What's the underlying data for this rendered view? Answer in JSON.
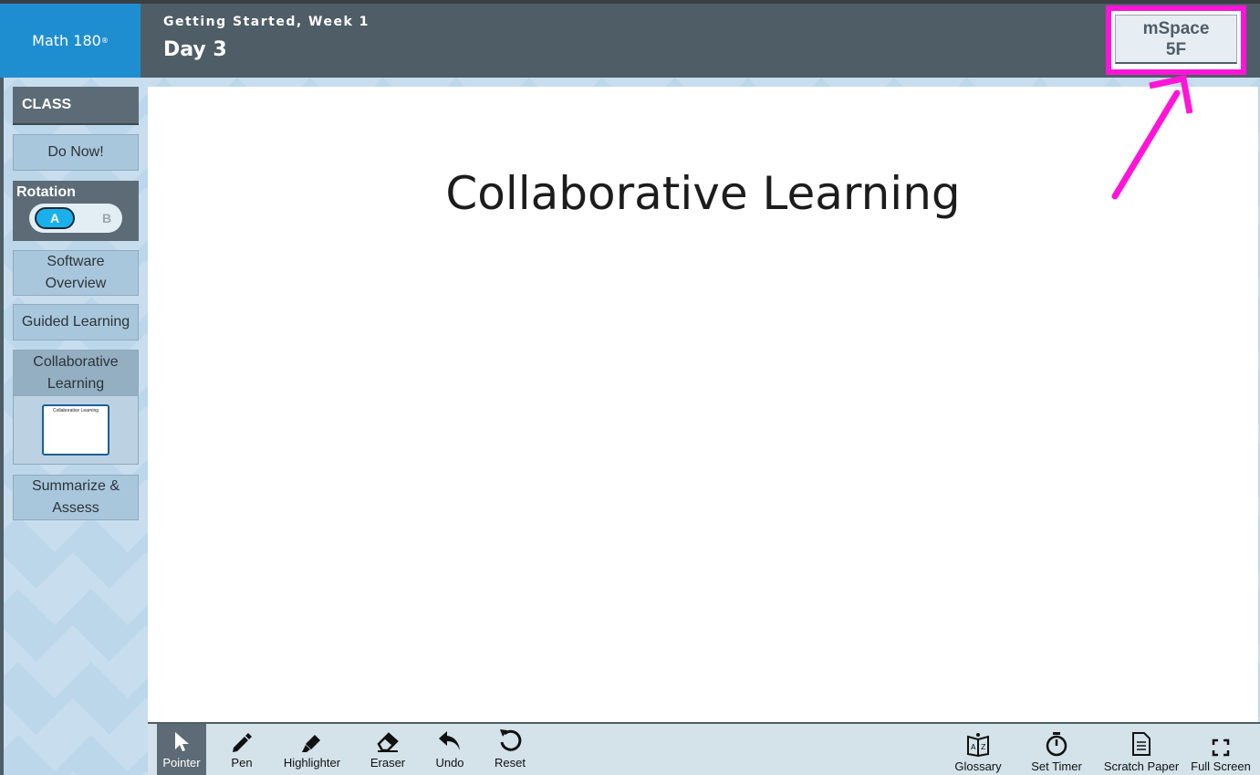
{
  "header": {
    "logo": "Math 180",
    "logo_mark": "®",
    "week": "Getting Started, Week 1",
    "day": "Day 3",
    "mspace_line1": "mSpace",
    "mspace_line2": "5F"
  },
  "sidebar": {
    "class_label": "CLASS",
    "do_now": "Do Now!",
    "rotation_label": "Rotation",
    "rotation_a": "A",
    "rotation_b": "B",
    "software_overview_1": "Software",
    "software_overview_2": "Overview",
    "guided_learning": "Guided Learning",
    "collaborative_1": "Collaborative",
    "collaborative_2": "Learning",
    "thumb_caption": "Collaborative Learning",
    "summarize_1": "Summarize &",
    "summarize_2": "Assess"
  },
  "main": {
    "title": "Collaborative Learning"
  },
  "toolbar": {
    "pointer": "Pointer",
    "pen": "Pen",
    "highlighter": "Highlighter",
    "eraser": "Eraser",
    "undo": "Undo",
    "reset": "Reset",
    "glossary": "Glossary",
    "set_timer": "Set Timer",
    "scratch_paper": "Scratch Paper",
    "full_screen": "Full Screen"
  },
  "colors": {
    "header_bg": "#4e5d66",
    "logo_bg": "#1e8ed0",
    "highlight_magenta": "#ff14d8",
    "rotation_active": "#1ab0ec"
  }
}
